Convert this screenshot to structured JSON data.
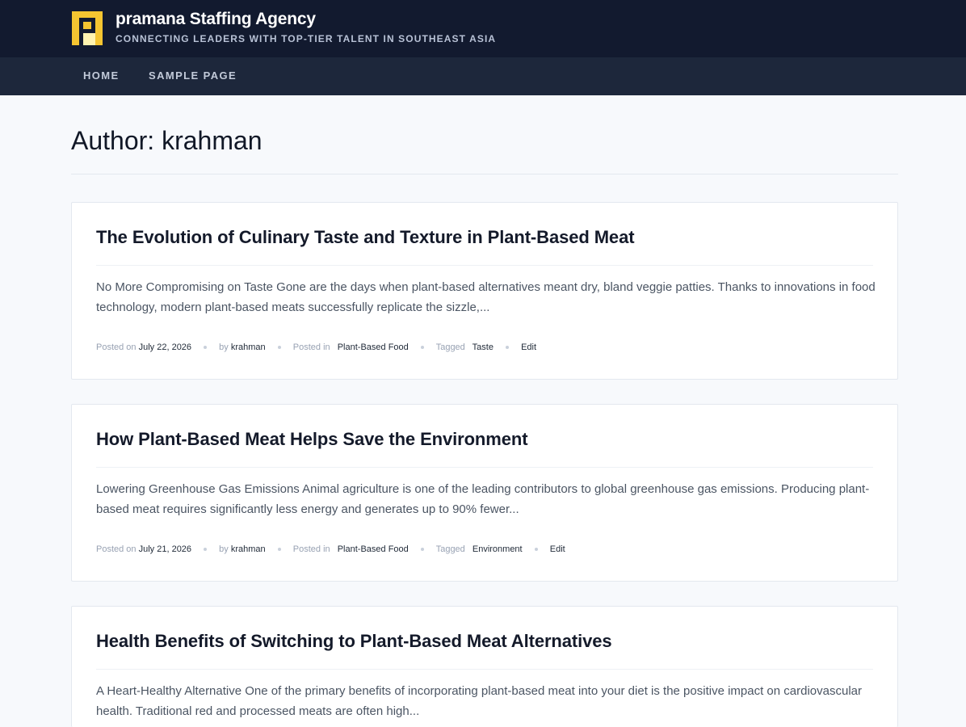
{
  "site": {
    "title": "pramana Staffing Agency",
    "tagline": "CONNECTING LEADERS WITH TOP-TIER TALENT IN SOUTHEAST ASIA",
    "logo_letter": "P",
    "colors": {
      "header_bg": "#121a2f",
      "nav_bg": "#1d273b",
      "logo_yellow": "#f5c531",
      "page_bg": "#f7f9fc"
    }
  },
  "nav": {
    "items": [
      {
        "label": "HOME"
      },
      {
        "label": "SAMPLE PAGE"
      }
    ]
  },
  "page": {
    "title": "Author: krahman"
  },
  "meta_labels": {
    "posted_on": "Posted on",
    "by": "by",
    "posted_in": "Posted in",
    "tagged": "Tagged",
    "edit": "Edit"
  },
  "posts": [
    {
      "title": "The Evolution of Culinary Taste and Texture in Plant-Based Meat",
      "excerpt": "No More Compromising on Taste Gone are the days when plant-based alternatives meant dry, bland veggie patties. Thanks to innovations in food technology, modern plant-based meats successfully replicate the sizzle,...",
      "date": "July 22, 2026",
      "author": "krahman",
      "category": "Plant-Based Food",
      "tag": "Taste"
    },
    {
      "title": "How Plant-Based Meat Helps Save the Environment",
      "excerpt": "Lowering Greenhouse Gas Emissions Animal agriculture is one of the leading contributors to global greenhouse gas emissions. Producing plant-based meat requires significantly less energy and generates up to 90% fewer...",
      "date": "July 21, 2026",
      "author": "krahman",
      "category": "Plant-Based Food",
      "tag": "Environment"
    },
    {
      "title": "Health Benefits of Switching to Plant-Based Meat Alternatives",
      "excerpt": "A Heart-Healthy Alternative One of the primary benefits of incorporating plant-based meat into your diet is the positive impact on cardiovascular health. Traditional red and processed meats are often high...",
      "date": "",
      "author": "",
      "category": "",
      "tag": ""
    }
  ]
}
